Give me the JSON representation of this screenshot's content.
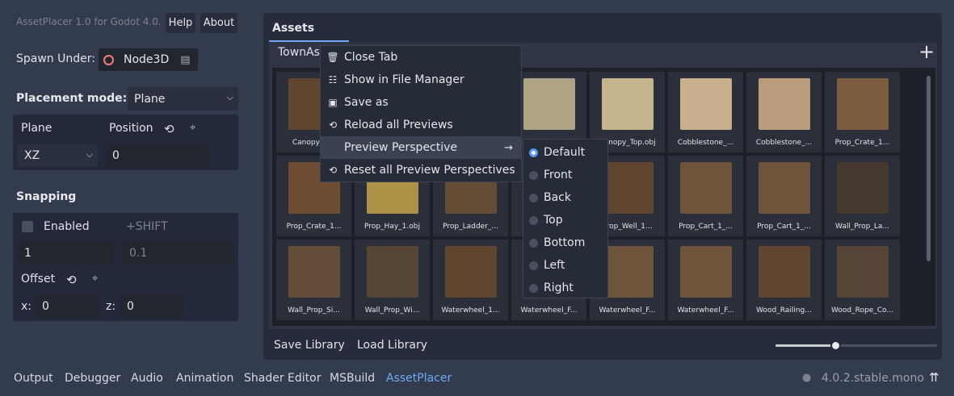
{
  "header": {
    "title": "AssetPlacer 1.0 for Godot 4.0.",
    "help": "Help",
    "about": "About"
  },
  "spawn": {
    "label": "Spawn Under:",
    "node": "Node3D"
  },
  "placement": {
    "label": "Placement mode:",
    "value": "Plane"
  },
  "plane": {
    "plane_label": "Plane",
    "position_label": "Position",
    "axis": "XZ",
    "position": "0"
  },
  "snapping": {
    "title": "Snapping",
    "enabled": "Enabled",
    "shift": "+SHIFT",
    "value1": "1",
    "value2": "0.1",
    "offset": "Offset",
    "x_label": "x:",
    "x": "0",
    "z_label": "z:",
    "z": "0"
  },
  "assets": {
    "title": "Assets",
    "tab": "TownAss",
    "tiles": [
      "Canopy_B...",
      "",
      "",
      "",
      "Canopy_Top.obj",
      "Cobblestone_...",
      "Cobblestone_...",
      "Prop_Crate_1...",
      "Prop_Crate_1...",
      "Prop_Hay_1.obj",
      "Prop_Ladder_...",
      "",
      "Prop_Well_1...",
      "Prop_Cart_1_...",
      "Prop_Cart_1_...",
      "Wall_Prop_La...",
      "Wall_Prop_Si...",
      "Wall_Prop_Wi...",
      "Waterwheel_1...",
      "Waterwheel_F...",
      "Waterwheel_F...",
      "Waterwheel_F...",
      "Wood_Railing...",
      "Wood_Rope_Co..."
    ],
    "save_library": "Save Library",
    "load_library": "Load Library",
    "zoom": 0.37
  },
  "context_menu": {
    "items": [
      "Close Tab",
      "Show in File Manager",
      "Save as",
      "Reload all Previews",
      "Preview Perspective",
      "Reset all Preview Perspectives"
    ],
    "icons": [
      "trash-icon",
      "file-manager-icon",
      "save-icon",
      "reload-icon",
      "",
      "reset-icon"
    ]
  },
  "perspective_menu": {
    "items": [
      "Default",
      "Front",
      "Back",
      "Top",
      "Bottom",
      "Left",
      "Right"
    ],
    "selected": "Default"
  },
  "bottom_bar": {
    "tabs": [
      "Output",
      "Debugger",
      "Audio",
      "Animation",
      "Shader Editor",
      "MSBuild",
      "AssetPlacer"
    ],
    "active": "AssetPlacer",
    "version": "4.0.2.stable.mono"
  },
  "colors": {
    "accent": "#6fa9f5",
    "background": "#333b4f",
    "panel": "#23283a"
  }
}
